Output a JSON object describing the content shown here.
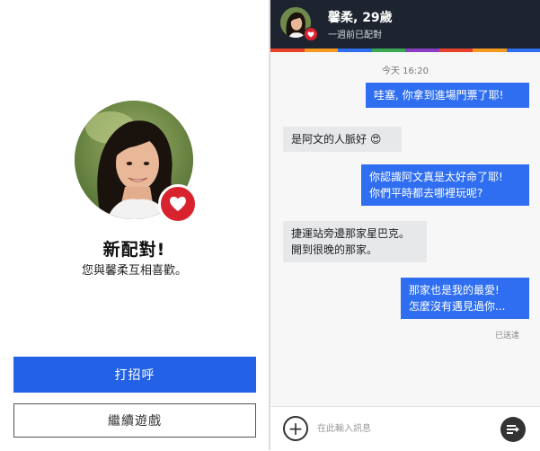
{
  "match_screen": {
    "title": "新配對!",
    "subtitle": "您與馨柔互相喜歡。",
    "primary_button": "打招呼",
    "secondary_button": "繼續遊戲",
    "badge_icon": "heart-icon"
  },
  "chat": {
    "header": {
      "name": "馨柔, 29歲",
      "status": "一週前已配對"
    },
    "timestamp": "今天 16:20",
    "messages": [
      {
        "direction": "out",
        "lines": [
          "哇塞, 你拿到進場門票了耶!"
        ]
      },
      {
        "direction": "in",
        "lines": [
          "是阿文的人脈好 😍"
        ]
      },
      {
        "direction": "out",
        "lines": [
          "你認識阿文真是太好命了耶!",
          "你們平時都去哪裡玩呢?"
        ]
      },
      {
        "direction": "in",
        "lines": [
          "捷運站旁邊那家星巴克。",
          "開到很晚的那家。"
        ]
      },
      {
        "direction": "out",
        "lines": [
          "那家也是我的最愛!",
          "怎麼沒有遇見過你..."
        ]
      }
    ],
    "read_receipt": "已送達",
    "composer": {
      "placeholder": "在此輸入訊息",
      "add_icon": "plus-icon",
      "send_icon": "send-icon"
    }
  },
  "colors": {
    "primary_blue": "#2362e6",
    "bubble_out": "#2f6ef0",
    "bubble_in": "#e7e8ea",
    "header_bg": "#1d2430",
    "heart_red": "#d8232e",
    "strip": [
      "#e8422d",
      "#f59a1c",
      "#2f6ef0",
      "#3aa853",
      "#8a3fc2",
      "#e8422d",
      "#f59a1c",
      "#2f6ef0"
    ]
  }
}
